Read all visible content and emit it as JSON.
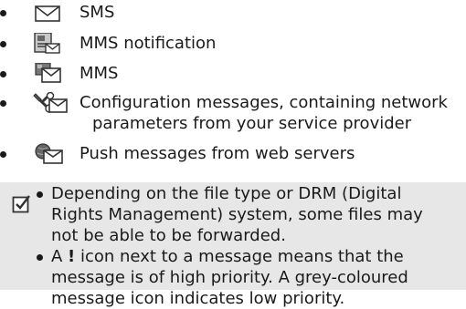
{
  "list": {
    "items": [
      {
        "icon": "sms-envelope-icon",
        "lines": [
          "SMS"
        ]
      },
      {
        "icon": "mms-notification-icon",
        "lines": [
          "MMS notification"
        ]
      },
      {
        "icon": "mms-icon",
        "lines": [
          "MMS"
        ]
      },
      {
        "icon": "configuration-message-icon",
        "lines": [
          "Configuration messages, containing network",
          "parameters from your service provider"
        ]
      },
      {
        "icon": "push-message-icon",
        "lines": [
          "Push messages from web servers"
        ]
      }
    ]
  },
  "note": {
    "icon": "checkbox-checked-icon",
    "bullets": [
      {
        "lines": [
          "Depending on the file type or DRM (Digital",
          "Rights Management) system, some files may",
          "not be able to be forwarded."
        ]
      },
      {
        "lines_rich": {
          "line1_pre": "A ",
          "line1_bold": "!",
          "line1_post": " icon next to a message means that the",
          "line2": "message is of high priority. A grey-coloured",
          "line3": "message icon indicates low priority."
        }
      }
    ]
  },
  "colors": {
    "text": "#1a1a1a",
    "note_background": "#e7e7e7"
  }
}
